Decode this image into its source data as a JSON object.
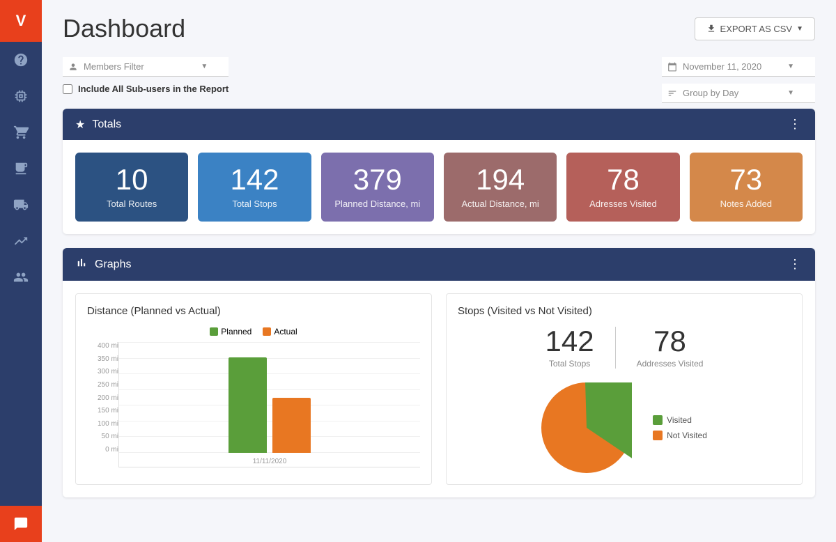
{
  "page": {
    "title": "Dashboard"
  },
  "header": {
    "export_label": "EXPORT AS CSV",
    "export_icon": "download-icon"
  },
  "filters": {
    "members_filter_placeholder": "Members Filter",
    "date_value": "November 11, 2020",
    "include_subusers_label": "Include All Sub-users in the Report",
    "group_by_label": "Group by Day"
  },
  "totals": {
    "section_title": "Totals",
    "cards": [
      {
        "num": "10",
        "label": "Total Routes",
        "color_class": "card-blue-dark"
      },
      {
        "num": "142",
        "label": "Total Stops",
        "color_class": "card-blue"
      },
      {
        "num": "379",
        "label": "Planned Distance, mi",
        "color_class": "card-purple"
      },
      {
        "num": "194",
        "label": "Actual Distance, mi",
        "color_class": "card-mauve"
      },
      {
        "num": "78",
        "label": "Adresses Visited",
        "color_class": "card-rose"
      },
      {
        "num": "73",
        "label": "Notes Added",
        "color_class": "card-orange"
      }
    ]
  },
  "graphs": {
    "section_title": "Graphs",
    "bar_chart": {
      "title": "Distance (Planned vs Actual)",
      "legend_planned": "Planned",
      "legend_actual": "Actual",
      "y_labels": [
        "400 mi",
        "350 mi",
        "300 mi",
        "250 mi",
        "200 mi",
        "150 mi",
        "100 mi",
        "50 mi",
        "0 mi"
      ],
      "x_label": "11/11/2020"
    },
    "pie_chart": {
      "title": "Stops (Visited vs Not Visited)",
      "total_stops_num": "142",
      "total_stops_label": "Total Stops",
      "addresses_visited_num": "78",
      "addresses_visited_label": "Addresses Visited",
      "legend_visited": "Visited",
      "legend_not_visited": "Not Visited"
    }
  },
  "sidebar": {
    "logo_text": "V",
    "nav_items": [
      {
        "name": "help",
        "icon": "?"
      },
      {
        "name": "routes",
        "icon": "⇌"
      },
      {
        "name": "cart",
        "icon": "🛒"
      },
      {
        "name": "layers",
        "icon": "≡"
      },
      {
        "name": "truck",
        "icon": "🚛"
      },
      {
        "name": "chart",
        "icon": "📈"
      },
      {
        "name": "users",
        "icon": "👥"
      }
    ],
    "chat_icon": "💬"
  }
}
